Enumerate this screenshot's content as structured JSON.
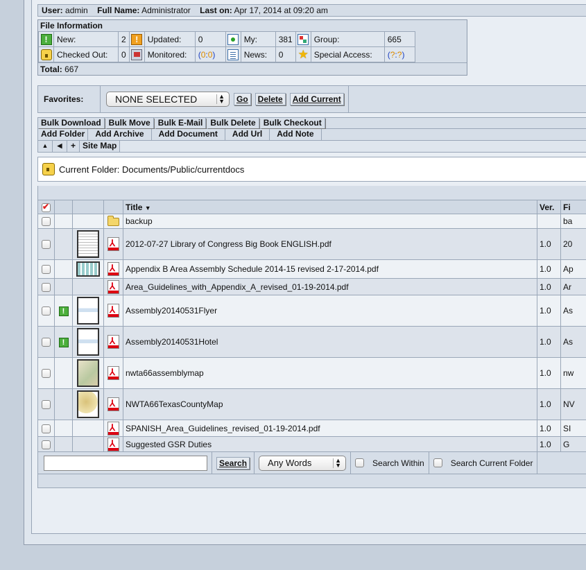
{
  "user": {
    "user_label": "User:",
    "user_value": "admin",
    "fullname_label": "Full Name:",
    "fullname_value": "Administrator",
    "laston_label": "Last on:",
    "laston_value": "Apr 17, 2014 at 09:20 am"
  },
  "file_info": {
    "title": "File Information",
    "new_label": "New:",
    "new_value": "2",
    "updated_label": "Updated:",
    "updated_value": "0",
    "my_label": "My:",
    "my_value": "381",
    "group_label": "Group:",
    "group_value": "665",
    "checkedout_label": "Checked Out:",
    "checkedout_value": "0",
    "monitored_label": "Monitored:",
    "monitored_open": "(",
    "monitored_a": "0",
    "monitored_sep": ":",
    "monitored_b": "0",
    "monitored_close": ")",
    "news_label": "News:",
    "news_value": "0",
    "special_label": "Special Access:",
    "special_open": "(",
    "special_a": "?",
    "special_sep": ":",
    "special_b": "?",
    "special_close": ")",
    "total_label": "Total:",
    "total_value": "667"
  },
  "favorites": {
    "label": "Favorites:",
    "selected": "NONE SELECTED",
    "go": "Go",
    "delete": "Delete",
    "add_current": "Add Current"
  },
  "bulk_actions": [
    "Bulk Download",
    "Bulk Move",
    "Bulk E-Mail",
    "Bulk Delete",
    "Bulk Checkout"
  ],
  "add_actions": [
    "Add Folder",
    "Add Archive",
    "Add Document",
    "Add Url",
    "Add Note"
  ],
  "nav": {
    "up": "▲",
    "back": "◀",
    "plus": "+",
    "site_map": "Site Map"
  },
  "current_folder": {
    "label": "Current Folder:",
    "path": "Documents/Public/currentdocs"
  },
  "columns": {
    "title": "Title",
    "ver": "Ver.",
    "file": "Fi"
  },
  "rows": [
    {
      "title": "backup",
      "ver": "",
      "file": "ba"
    },
    {
      "title": "2012-07-27 Library of Congress Big Book ENGLISH.pdf",
      "ver": "1.0",
      "file": "20"
    },
    {
      "title": "Appendix B Area Assembly Schedule 2014-15 revised 2-17-2014.pdf",
      "ver": "1.0",
      "file": "Ap"
    },
    {
      "title": "Area_Guidelines_with_Appendix_A_revised_01-19-2014.pdf",
      "ver": "1.0",
      "file": "Ar"
    },
    {
      "title": "Assembly20140531Flyer",
      "ver": "1.0",
      "file": "As"
    },
    {
      "title": "Assembly20140531Hotel",
      "ver": "1.0",
      "file": "As"
    },
    {
      "title": "nwta66assemblymap",
      "ver": "1.0",
      "file": "nw"
    },
    {
      "title": "NWTA66TexasCountyMap",
      "ver": "1.0",
      "file": "NV"
    },
    {
      "title": "SPANISH_Area_Guidelines_revised_01-19-2014.pdf",
      "ver": "1.0",
      "file": "SI"
    },
    {
      "title": "Suggested GSR Duties",
      "ver": "1.0",
      "file": "G"
    }
  ],
  "search": {
    "button": "Search",
    "mode": "Any Words",
    "within": "Search Within",
    "current_folder": "Search Current Folder"
  },
  "icons": {
    "new": "exclamation-green-icon",
    "updated": "exclamation-orange-icon",
    "my": "green-dot-icon",
    "group": "group-icon",
    "checked_out": "lock-icon",
    "monitored": "monitor-icon",
    "news": "news-icon",
    "special": "star-icon"
  }
}
